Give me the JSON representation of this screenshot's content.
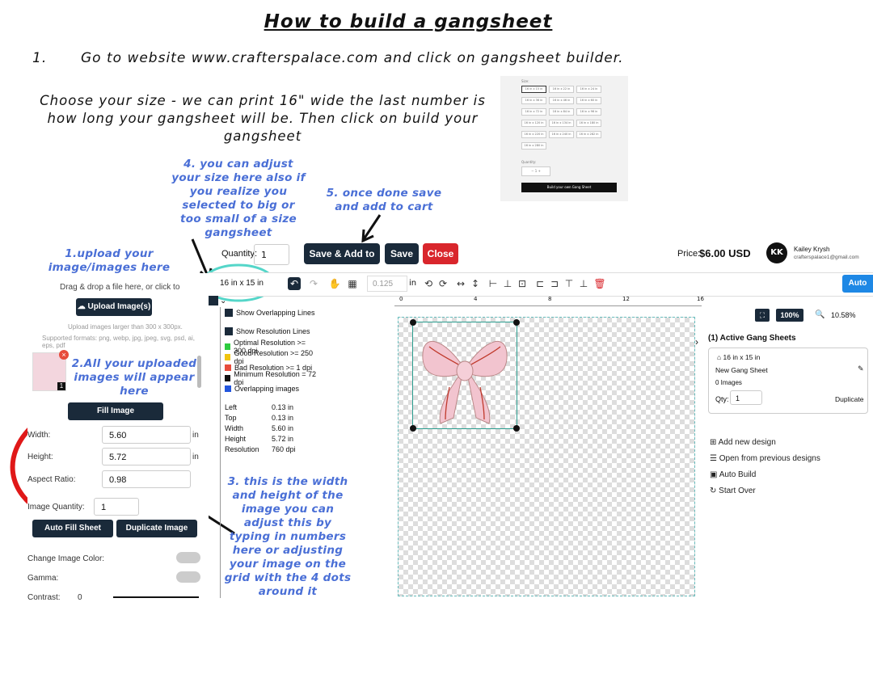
{
  "doc": {
    "title": "How to build a gangsheet",
    "step1_num": "1.",
    "step1_text": "Go to website www.crafterspalace.com and click on gangsheet builder.",
    "choose_text": "Choose your size - we can print 16\" wide the last number is how long your gangsheet will be. Then click on build your gangsheet",
    "note_upload": "1.upload your image/images here",
    "note_uploaded": "2.All your uploaded images will appear here",
    "note_size": "4. you can adjust your size here also if you realize you selected to big or too small of a size gangsheet",
    "note_save": "5. once done save and add to cart",
    "note_width": "3. this is the width and height of the image you can adjust this by typing in numbers here or adjusting your image on the grid with the 4 dots around it"
  },
  "size_thumb": {
    "size_label": "Size:",
    "chips": [
      "16 in x 15 in",
      "16 in x 22 in",
      "16 in x 24 in",
      "16 in x 36 in",
      "16 in x 46 in",
      "16 in x 60 in",
      "16 in x 72 in",
      "16 in x 84 in",
      "16 in x 96 in",
      "16 in x 120 in",
      "16 in x 134 in",
      "16 in x 180 in",
      "16 in x 220 in",
      "16 in x 240 in",
      "16 in x 282 in",
      "16 in x 280 in"
    ],
    "quantity_label": "Quantity:",
    "quantity_value": "−   1   +",
    "build_button": "Build your own Gang Sheet"
  },
  "app": {
    "quantity_label": "Quantity:",
    "quantity_value": "1",
    "save_add_cart": "Save & Add to Cart",
    "save": "Save",
    "close": "Close",
    "price_label": "Price:",
    "price_value": "$6.00 USD",
    "avatar_initials": "KK",
    "user_name": "Kailey Krysh",
    "user_email": "crafterspalace1@gmail.com",
    "auto_btn": "Auto",
    "size_select": "16 in x 15 in",
    "stroke_value": "0.125",
    "stroke_unit": "in",
    "ruler_marks": [
      "0",
      "4",
      "8",
      "12",
      "16"
    ]
  },
  "sidebar": {
    "drag_text": "Drag & drop a file here, or click to",
    "upload_button": "Upload Image(s)",
    "hint": "Upload images larger than 300 x 300px.",
    "formats": "Supported formats: png, webp, jpg, jpeg, svg, psd, ai, eps, pdf",
    "thumb_count": "1",
    "fill_button": "Fill Image",
    "width_label": "Width:",
    "width_value": "5.60",
    "height_label": "Height:",
    "height_value": "5.72",
    "aspect_label": "Aspect Ratio:",
    "aspect_value": "0.98",
    "unit": "in",
    "qty_label": "Image Quantity:",
    "qty_value": "1",
    "auto_fill": "Auto Fill Sheet",
    "duplicate": "Duplicate Image",
    "change_color": "Change Image Color:",
    "gamma": "Gamma:",
    "contrast": "Contrast:",
    "contrast_value": "0"
  },
  "legend": {
    "show_overlapping": "Show Overlapping Lines",
    "show_resolution": "Show Resolution Lines",
    "items": [
      {
        "label": "Optimal Resolution >= 300 dpi",
        "color": "#2ecc40"
      },
      {
        "label": "Good Resolution >= 250 dpi",
        "color": "#f1c40f"
      },
      {
        "label": "Bad Resolution >= 1 dpi",
        "color": "#e74c3c"
      },
      {
        "label": "Minimum Resolution = 72 dpi",
        "color": "#111111"
      },
      {
        "label": "Overlapping images",
        "color": "#2255dd"
      }
    ],
    "props": [
      {
        "k": "Left",
        "v": "0.13 in"
      },
      {
        "k": "Top",
        "v": "0.13 in"
      },
      {
        "k": "Width",
        "v": "5.60 in"
      },
      {
        "k": "Height",
        "v": "5.72 in"
      },
      {
        "k": "Resolution",
        "v": "760 dpi"
      }
    ]
  },
  "right": {
    "zoom": "100%",
    "zoom2": "10.58%",
    "active_title": "(1)  Active Gang Sheets",
    "sheet_size": "16 in x 15 in",
    "sheet_name": "New Gang Sheet",
    "images": "0 Images",
    "qty_label": "Qty:",
    "qty_value": "1",
    "duplicate": "Duplicate",
    "add_new": "Add new design",
    "open_prev": "Open from previous designs",
    "auto_build": "Auto Build",
    "start_over": "Start Over"
  },
  "colors": {
    "accent_note": "#4a6fd6",
    "close_red": "#d9262c",
    "navy": "#1a2a3a",
    "teal_circle": "#55d6c9",
    "red_circle": "#e01818"
  }
}
